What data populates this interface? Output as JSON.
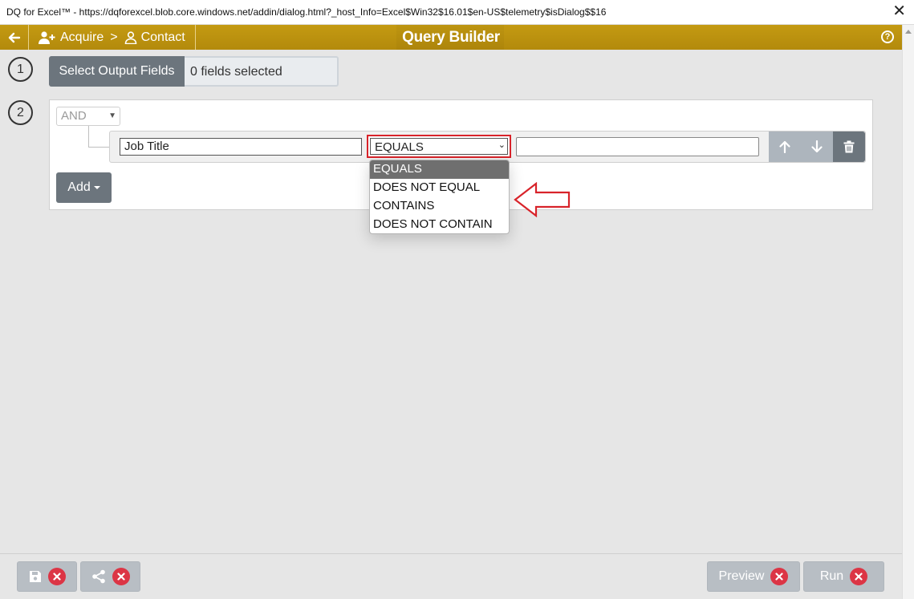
{
  "window": {
    "title": "DQ for Excel™ - https://dqforexcel.blob.core.windows.net/addin/dialog.html?_host_Info=Excel$Win32$16.01$en-US$telemetry$isDialog$$16",
    "close_glyph": "✕"
  },
  "header": {
    "back_icon": "arrow-left-icon",
    "breadcrumb": {
      "item1": "Acquire",
      "separator": ">",
      "item2": "Contact"
    },
    "title": "Query Builder",
    "help_glyph": "?",
    "color": "#b8900e"
  },
  "step1": {
    "number": "1",
    "button_label": "Select Output Fields",
    "fields_status": "0 fields selected"
  },
  "step2": {
    "number": "2",
    "conjunction": "AND",
    "rule": {
      "field": "Job Title",
      "operator": "EQUALS",
      "value": ""
    },
    "operator_options": [
      "EQUALS",
      "DOES NOT EQUAL",
      "CONTAINS",
      "DOES NOT CONTAIN"
    ],
    "selected_option": "EQUALS",
    "add_label": "Add"
  },
  "footer": {
    "save_icon": "save-icon",
    "share_icon": "share-icon",
    "preview_label": "Preview",
    "run_label": "Run"
  },
  "colors": {
    "highlight": "#d8232a",
    "button_dark": "#6c757d",
    "button_disabled": "#b8bec4",
    "error_badge": "#dc3545"
  }
}
